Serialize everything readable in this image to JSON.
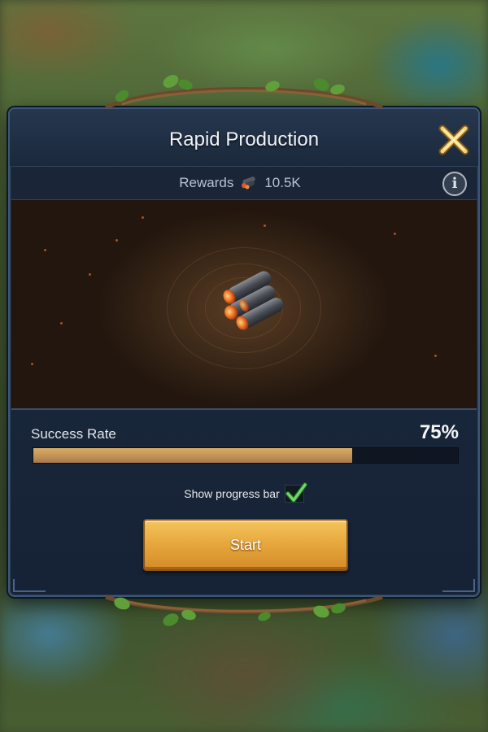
{
  "dialog": {
    "title": "Rapid Production",
    "rewards": {
      "label": "Rewards",
      "value": "10.5K",
      "icon": "coal-icon"
    },
    "success": {
      "label": "Success Rate",
      "value": "75%",
      "fraction": 0.75
    },
    "show_progress": {
      "label": "Show progress bar",
      "checked": true
    },
    "start_label": "Start",
    "close_icon": "close-icon",
    "info_icon": "info-icon",
    "info_glyph": "i"
  },
  "colors": {
    "accent_gold": "#e7a93e",
    "progress_fill": "#c09055",
    "panel_bg": "#1d2c40",
    "check_green": "#6fd66a"
  }
}
